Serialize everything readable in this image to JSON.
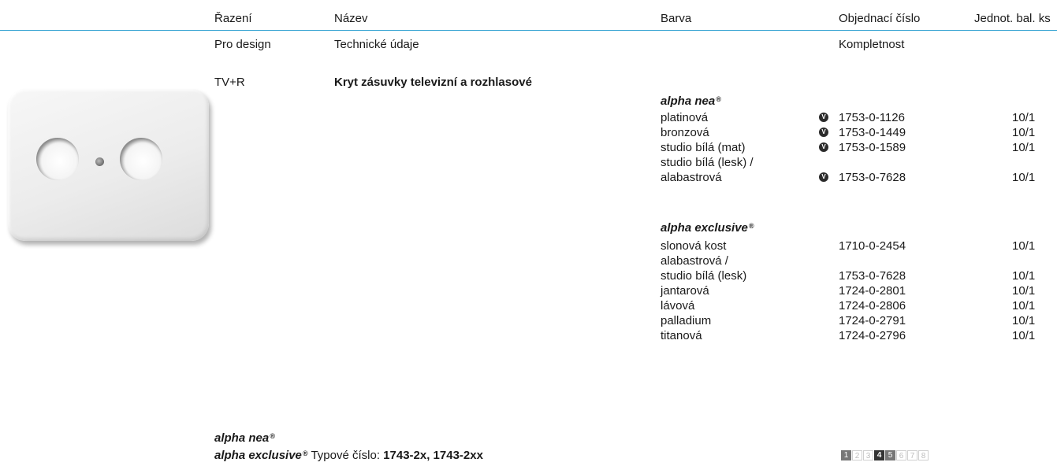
{
  "header": {
    "col_razeni": "Řazení",
    "col_nazev": "Název",
    "col_barva": "Barva",
    "col_obj": "Objednací číslo",
    "col_jednot": "Jednot. bal. ks"
  },
  "subheader": {
    "pro_design": "Pro design",
    "tech": "Technické údaje",
    "kompletnost": "Kompletnost"
  },
  "product": {
    "razeni": "TV+R",
    "nazev": "Kryt zásuvky televizní a rozhlasové",
    "image_icon": "socket-cover-image"
  },
  "series": [
    {
      "brand": "alpha nea",
      "reg": "®",
      "rows": [
        {
          "color": "platinová",
          "marked": true,
          "code": "1753-0-1126",
          "pack": "10/1"
        },
        {
          "color": "bronzová",
          "marked": true,
          "code": "1753-0-1449",
          "pack": "10/1"
        },
        {
          "color": "studio bílá (mat)",
          "marked": true,
          "code": "1753-0-1589",
          "pack": "10/1"
        },
        {
          "color": "studio bílá (lesk) /",
          "marked": false,
          "code": "",
          "pack": ""
        },
        {
          "color": "alabastrová",
          "marked": true,
          "code": "1753-0-7628",
          "pack": "10/1"
        }
      ]
    },
    {
      "brand": "alpha exclusive",
      "reg": "®",
      "rows": [
        {
          "color": "slonová kost",
          "marked": false,
          "code": "1710-0-2454",
          "pack": "10/1"
        },
        {
          "color": "alabastrová /",
          "marked": false,
          "code": "",
          "pack": ""
        },
        {
          "color": "studio bílá (lesk)",
          "marked": false,
          "code": "1753-0-7628",
          "pack": "10/1"
        },
        {
          "color": "jantarová",
          "marked": false,
          "code": "1724-0-2801",
          "pack": "10/1"
        },
        {
          "color": "lávová",
          "marked": false,
          "code": "1724-0-2806",
          "pack": "10/1"
        },
        {
          "color": "palladium",
          "marked": false,
          "code": "1724-0-2791",
          "pack": "10/1"
        },
        {
          "color": "titanová",
          "marked": false,
          "code": "1724-0-2796",
          "pack": "10/1"
        }
      ]
    }
  ],
  "marker_glyph": "V",
  "footer": {
    "brand1": "alpha nea",
    "brand2": "alpha exclusive",
    "reg": "®",
    "type_label": "Typové číslo:",
    "type_value": "1743-2x, 1743-2xx",
    "pages": [
      {
        "n": "1",
        "state": "on"
      },
      {
        "n": "2",
        "state": "off"
      },
      {
        "n": "3",
        "state": "off"
      },
      {
        "n": "4",
        "state": "bold-on"
      },
      {
        "n": "5",
        "state": "on"
      },
      {
        "n": "6",
        "state": "off"
      },
      {
        "n": "7",
        "state": "off"
      },
      {
        "n": "8",
        "state": "off"
      }
    ]
  },
  "colors": {
    "rule": "#2a9fd0",
    "text": "#1a1a1a"
  }
}
